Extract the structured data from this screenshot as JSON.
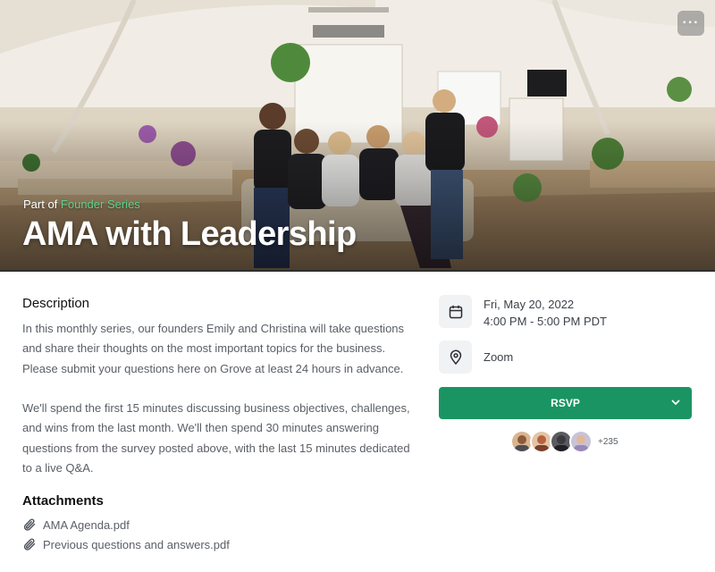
{
  "hero": {
    "series_prefix": "Part of",
    "series_name": "Founder Series",
    "title": "AMA with Leadership",
    "menu_glyph": "···"
  },
  "description": {
    "heading": "Description",
    "paragraphs": [
      "In this monthly series, our founders Emily and Christina will take questions and share their thoughts on the most important topics for the business. Please submit your questions here on Grove at least 24 hours in advance.",
      "We'll spend the first 15 minutes discussing business objectives, challenges, and wins from the last month. We'll then spend 30 minutes answering questions from the survey posted above, with the last 15 minutes dedicated to a live Q&A."
    ]
  },
  "attachments": {
    "heading": "Attachments",
    "files": [
      "AMA Agenda.pdf",
      "Previous questions and answers.pdf"
    ]
  },
  "event_info": {
    "date": "Fri, May 20, 2022",
    "time": "4:00 PM - 5:00 PM PDT",
    "location": "Zoom",
    "date_icon": "calendar-icon",
    "location_icon": "map-pin-icon"
  },
  "rsvp": {
    "label": "RSVP",
    "color": "#1a9463"
  },
  "attendees": {
    "extra_count": "+235",
    "avatar_colors": [
      "#8a5a3c",
      "#b8623e",
      "#3b3a3f",
      "#9a88b8"
    ]
  },
  "colors": {
    "accent": "#1a9463",
    "series_link": "#5fd18e"
  }
}
